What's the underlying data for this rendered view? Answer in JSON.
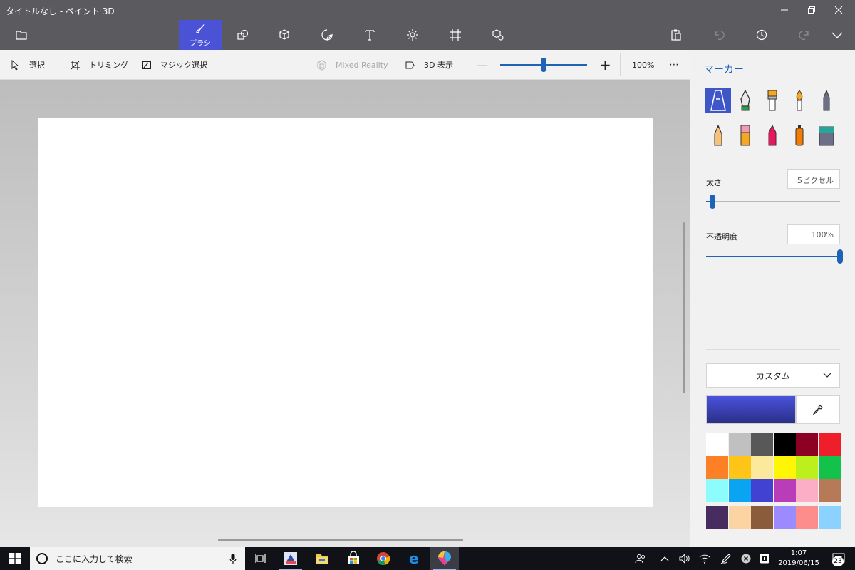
{
  "window": {
    "title": "タイトルなし - ペイント 3D",
    "controls": [
      "minimize",
      "restore",
      "close"
    ]
  },
  "top_tools": {
    "active_label": "ブラシ",
    "items": [
      "menu-icon",
      "brush-icon",
      "2d-shapes-icon",
      "3d-shapes-icon",
      "stickers-icon",
      "text-icon",
      "effects-icon",
      "canvas-icon",
      "3d-library-icon"
    ]
  },
  "right_tools": [
    "paste-icon",
    "undo-icon",
    "history-icon",
    "redo-icon",
    "expand-icon"
  ],
  "toolbar2": {
    "select": "選択",
    "crop": "トリミング",
    "magic_select": "マジック選択",
    "mixed_reality": "Mixed Reality",
    "view_3d": "3D 表示",
    "zoom_minus": "—",
    "zoom_plus": "+",
    "zoom_value": "100%",
    "zoom_fraction": 0.5,
    "more": "⋯"
  },
  "panel": {
    "title": "マーカー",
    "brushes": [
      {
        "name": "marker",
        "selected": true
      },
      {
        "name": "calligraphy-pen"
      },
      {
        "name": "oil-brush"
      },
      {
        "name": "watercolor"
      },
      {
        "name": "pixel-pen"
      },
      {
        "name": "pencil"
      },
      {
        "name": "eraser"
      },
      {
        "name": "crayon"
      },
      {
        "name": "spraycan"
      },
      {
        "name": "fill"
      }
    ],
    "thickness_label": "太さ",
    "thickness_value": "5ピクセル",
    "thickness_fraction": 0.05,
    "opacity_label": "不透明度",
    "opacity_value": "100%",
    "opacity_fraction": 1.0,
    "color_mode": "カスタム",
    "current_color_top": "#4b52dc",
    "current_color_bottom": "#2a2f86",
    "palette": [
      "#ffffff",
      "#c0c0c0",
      "#585858",
      "#000000",
      "#8b0023",
      "#ee1f2a",
      "#fd8026",
      "#fec518",
      "#fde99b",
      "#fef507",
      "#bbf01d",
      "#13c24b",
      "#8cfdfc",
      "#0aa4f2",
      "#4141d2",
      "#b93db8",
      "#fcaec7",
      "#b67a59",
      "#472c5f",
      "#fad5a3",
      "#8a5c3c",
      "#9c8bfe",
      "#fd8c8c",
      "#8cd2fe"
    ]
  },
  "taskbar": {
    "search_placeholder": "ここに入力して検索",
    "apps": [
      "task-view-icon",
      "paint3d-editor-icon",
      "file-explorer-icon",
      "store-icon",
      "chrome-icon",
      "edge-icon",
      "paint3d-icon"
    ],
    "time": "1:07",
    "date": "2019/06/15",
    "notification_count": "23"
  }
}
